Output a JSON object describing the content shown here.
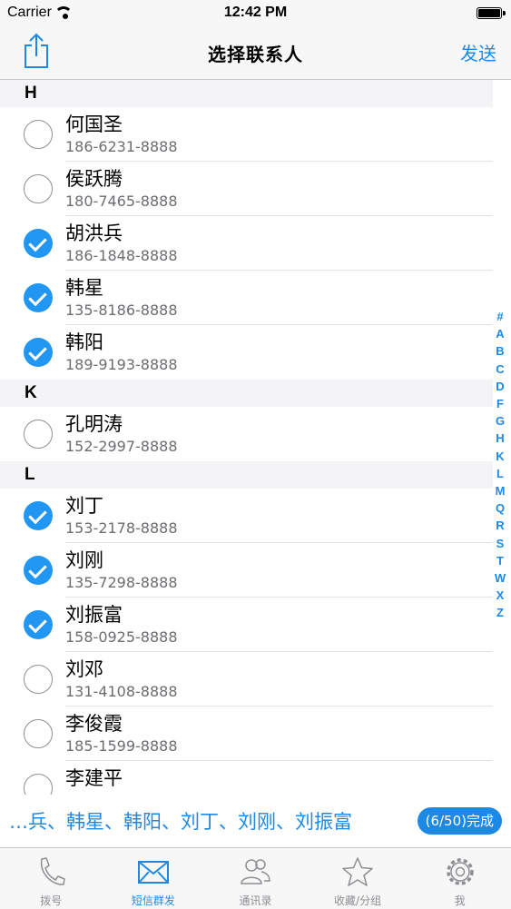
{
  "status_bar": {
    "carrier": "Carrier",
    "time": "12:42 PM"
  },
  "nav": {
    "title": "选择联系人",
    "send_label": "发送",
    "share_icon": "share-icon"
  },
  "sections": [
    {
      "letter": "H",
      "contacts": [
        {
          "name": "何国圣",
          "phone": "186-6231-8888",
          "checked": false
        },
        {
          "name": "侯跃腾",
          "phone": "180-7465-8888",
          "checked": false
        },
        {
          "name": "胡洪兵",
          "phone": "186-1848-8888",
          "checked": true
        },
        {
          "name": "韩星",
          "phone": "135-8186-8888",
          "checked": true
        },
        {
          "name": "韩阳",
          "phone": "189-9193-8888",
          "checked": true
        }
      ]
    },
    {
      "letter": "K",
      "contacts": [
        {
          "name": "孔明涛",
          "phone": "152-2997-8888",
          "checked": false
        }
      ]
    },
    {
      "letter": "L",
      "contacts": [
        {
          "name": "刘丁",
          "phone": "153-2178-8888",
          "checked": true
        },
        {
          "name": "刘刚",
          "phone": "135-7298-8888",
          "checked": true
        },
        {
          "name": "刘振富",
          "phone": "158-0925-8888",
          "checked": true
        },
        {
          "name": "刘邓",
          "phone": "131-4108-8888",
          "checked": false
        },
        {
          "name": "李俊霞",
          "phone": "185-1599-8888",
          "checked": false
        },
        {
          "name": "李建平",
          "phone": "",
          "checked": false
        }
      ]
    }
  ],
  "index_letters": [
    "#",
    "A",
    "B",
    "C",
    "D",
    "F",
    "G",
    "H",
    "K",
    "L",
    "M",
    "Q",
    "R",
    "S",
    "T",
    "W",
    "X",
    "Z"
  ],
  "selection": {
    "names": "…兵、韩星、韩阳、刘丁、刘刚、刘振富",
    "done_label": "(6/50)完成"
  },
  "tabs": [
    {
      "label": "拨号",
      "icon": "phone-icon",
      "active": false
    },
    {
      "label": "短信群发",
      "icon": "envelope-icon",
      "active": true
    },
    {
      "label": "通讯录",
      "icon": "contacts-icon",
      "active": false
    },
    {
      "label": "收藏/分组",
      "icon": "star-icon",
      "active": false
    },
    {
      "label": "我",
      "icon": "gear-icon",
      "active": false
    }
  ],
  "colors": {
    "accent": "#1e88e5",
    "check": "#2196f3"
  }
}
